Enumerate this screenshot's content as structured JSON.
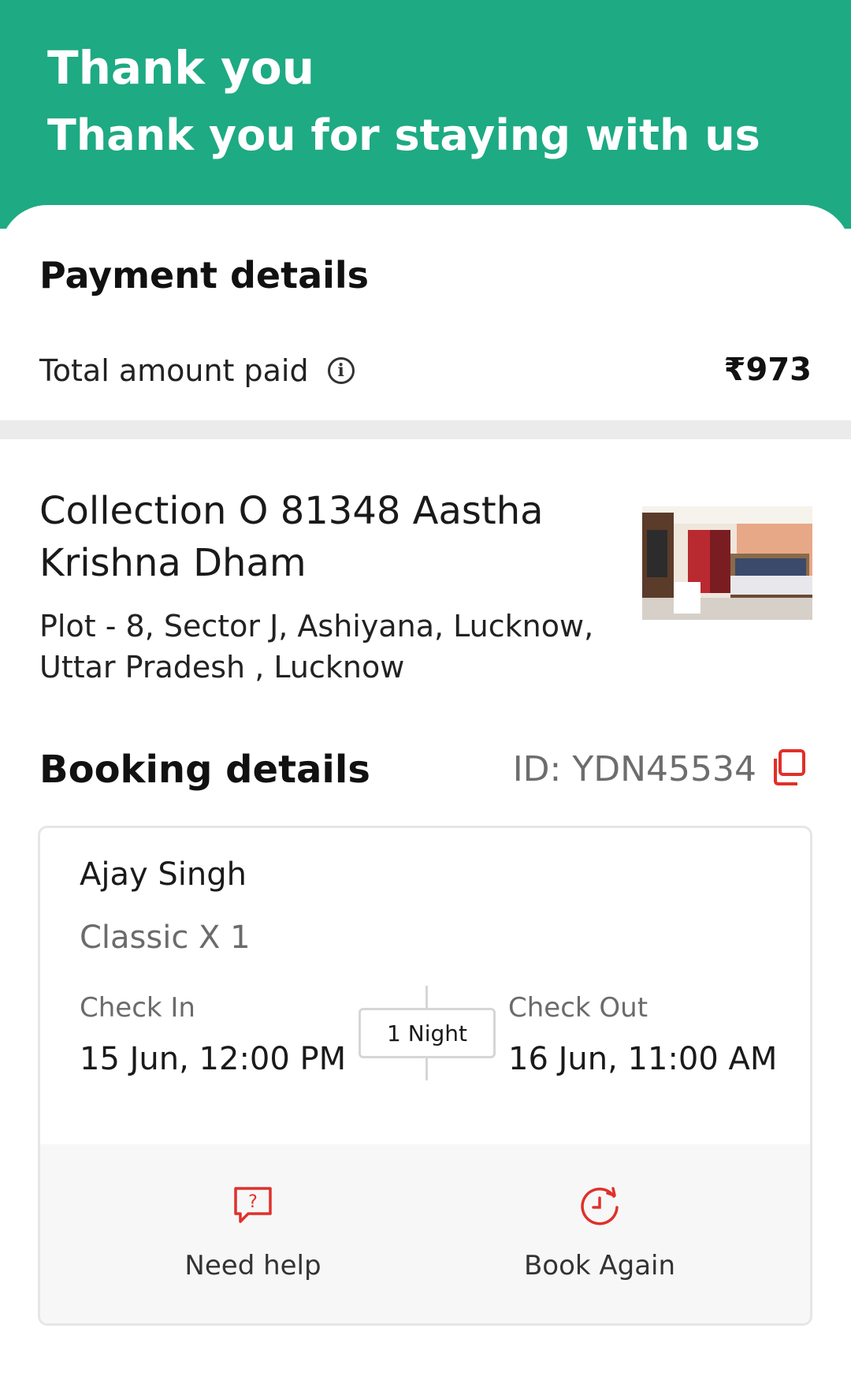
{
  "header": {
    "title": "Thank you",
    "subtitle": "Thank you for staying with us"
  },
  "payment": {
    "section_title": "Payment details",
    "total_label": "Total amount paid",
    "total_amount": "₹973",
    "info_icon": "info-icon"
  },
  "hotel": {
    "name": "Collection O 81348 Aastha Krishna Dham",
    "address": "Plot - 8, Sector J, Ashiyana, Lucknow, Uttar Pradesh , Lucknow",
    "photo": "hotel-room-photo"
  },
  "booking": {
    "section_title": "Booking details",
    "id_text": "ID: YDN45534",
    "copy_icon": "copy-icon",
    "guest_name": "Ajay Singh",
    "room": "Classic X 1",
    "check_in_label": "Check In",
    "check_in_value": "15 Jun, 12:00 PM",
    "check_out_label": "Check Out",
    "check_out_value": "16 Jun, 11:00 AM",
    "nights": "1 Night"
  },
  "actions": {
    "help_label": "Need help",
    "help_icon": "question-chat-icon",
    "book_again_label": "Book Again",
    "book_again_icon": "clock-refresh-icon"
  },
  "colors": {
    "brand": "#1eaa83",
    "accent_icon": "#e0302a"
  }
}
